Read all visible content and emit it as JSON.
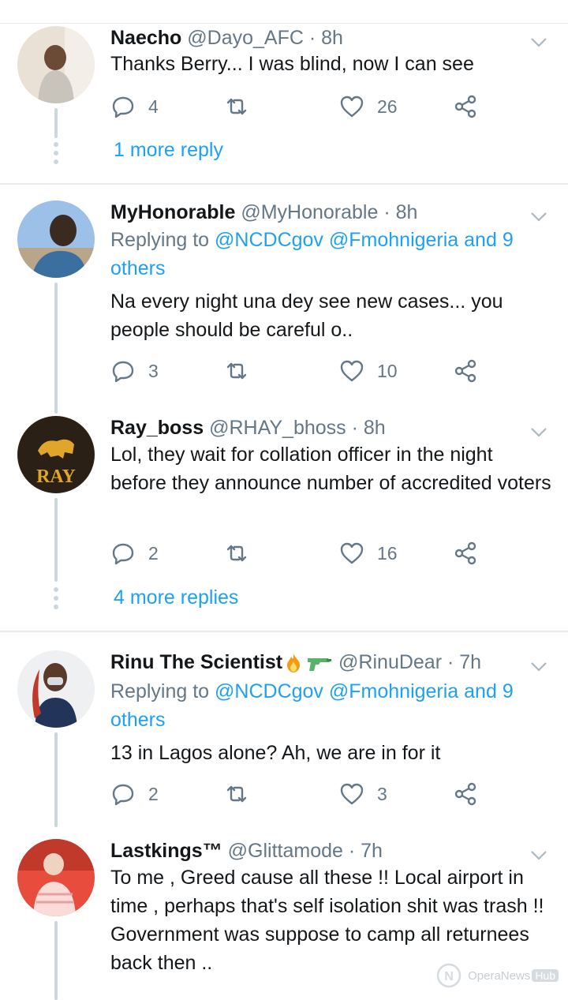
{
  "tweets": [
    {
      "name": "Naecho",
      "handle": "@Dayo_AFC · 8h",
      "text": "Thanks Berry... I was blind, now I can see",
      "replies": "4",
      "likes": "26",
      "more": "1 more reply"
    },
    {
      "name": "MyHonorable",
      "handle": "@MyHonorable · 8h",
      "replying_prefix": "Replying to ",
      "replying_links": "@NCDCgov @Fmohnigeria and 9 others",
      "text": "Na every night una dey see new cases... you people should be careful o..",
      "replies": "3",
      "likes": "10"
    },
    {
      "name": "Ray_boss",
      "handle": "@RHAY_bhoss · 8h",
      "text": "Lol,  they wait for collation officer in the night before they announce number of accredited voters",
      "replies": "2",
      "likes": "16",
      "more": "4 more replies",
      "avatar_text": "RAY"
    },
    {
      "name": "Rinu The Scientist",
      "handle": "@RinuDear · 7h",
      "replying_prefix": "Replying to ",
      "replying_links": "@NCDCgov @Fmohnigeria and 9 others",
      "text": "13 in Lagos alone? Ah, we are in for it",
      "replies": "2",
      "likes": "3"
    },
    {
      "name": "Lastkings™",
      "handle": "@Glittamode · 7h",
      "text": "To me , Greed cause all these !! Local airport in time , perhaps that's self isolation shit was trash !! Government was suppose to camp all returnees back then .."
    }
  ],
  "watermark": {
    "text": "OperaNews",
    "hub": "Hub"
  },
  "colors": {
    "accent": "#1da1f2",
    "muted": "#657786",
    "line": "#ccd6dd"
  }
}
